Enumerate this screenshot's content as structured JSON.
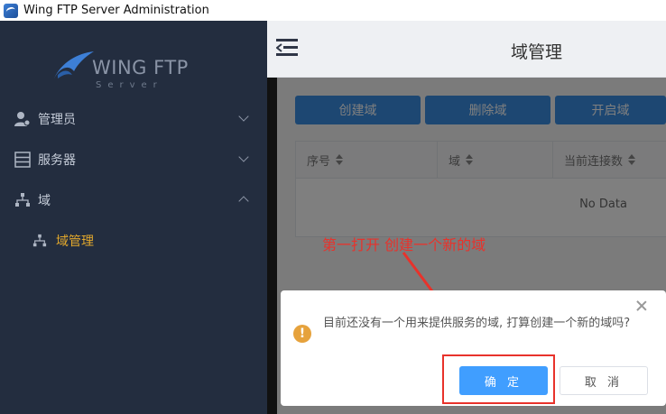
{
  "window": {
    "title": "Wing FTP Server Administration",
    "icon": "wing-ftp-app-icon"
  },
  "sidebar": {
    "logo_main": "WING FTP",
    "logo_sub": "Server",
    "items": [
      {
        "label": "管理员",
        "icon": "admin-user-icon",
        "expanded": false
      },
      {
        "label": "服务器",
        "icon": "server-icon",
        "expanded": false
      },
      {
        "label": "域",
        "icon": "domain-tree-icon",
        "expanded": true
      }
    ],
    "subitems": [
      {
        "label": "域管理",
        "icon": "domain-tree-icon",
        "active": true,
        "color": "#e1a72c"
      }
    ]
  },
  "header": {
    "title": "域管理",
    "menu_icon": "collapse-menu-icon"
  },
  "toolbar": {
    "buttons": [
      "创建域",
      "删除域",
      "开启域"
    ],
    "button_color": "#3b8fe4"
  },
  "table": {
    "columns": [
      "序号",
      "域",
      "当前连接数"
    ],
    "empty_text": "No Data"
  },
  "annotation": {
    "text": "第一打开 创建一个新的域",
    "color": "#e8322b"
  },
  "dialog": {
    "message": "目前还没有一个用来提供服务的域, 打算创建一个新的域吗?",
    "icon": "warning-icon",
    "confirm": "确 定",
    "cancel": "取 消",
    "accent": "#409eff"
  }
}
